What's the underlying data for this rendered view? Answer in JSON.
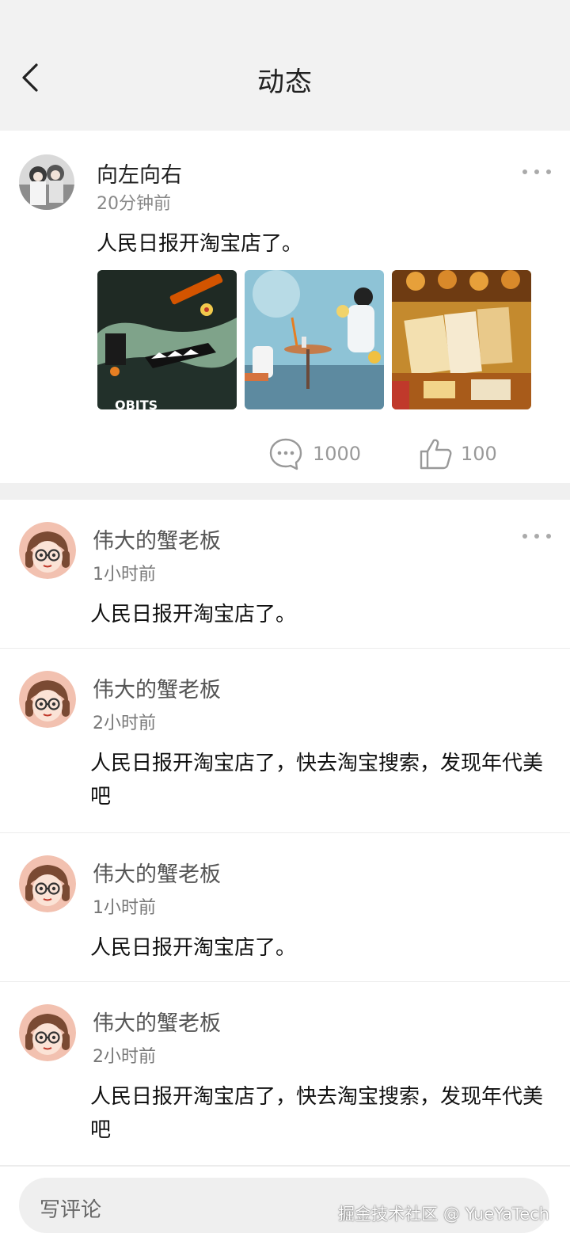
{
  "header": {
    "title": "动态"
  },
  "post": {
    "username": "向左向右",
    "time": "20分钟前",
    "text": "人民日报开淘宝店了。",
    "comment_count": "1000",
    "like_count": "100"
  },
  "comments": [
    {
      "username": "伟大的蟹老板",
      "time": "1小时前",
      "text": "人民日报开淘宝店了。"
    },
    {
      "username": "伟大的蟹老板",
      "time": "2小时前",
      "text": "人民日报开淘宝店了，快去淘宝搜索，发现年代美吧"
    },
    {
      "username": "伟大的蟹老板",
      "time": "1小时前",
      "text": "人民日报开淘宝店了。"
    },
    {
      "username": "伟大的蟹老板",
      "time": "2小时前",
      "text": "人民日报开淘宝店了，快去淘宝搜索，发现年代美吧"
    }
  ],
  "bottom": {
    "placeholder": "写评论",
    "watermark": "掘金技术社区 @ YueYaTech"
  },
  "colors": {
    "header_bg": "#f2f2f2",
    "divider": "#f0f0f0",
    "muted_text": "#888888"
  },
  "icons": [
    "back-icon",
    "more-icon",
    "comment-icon",
    "like-icon"
  ]
}
